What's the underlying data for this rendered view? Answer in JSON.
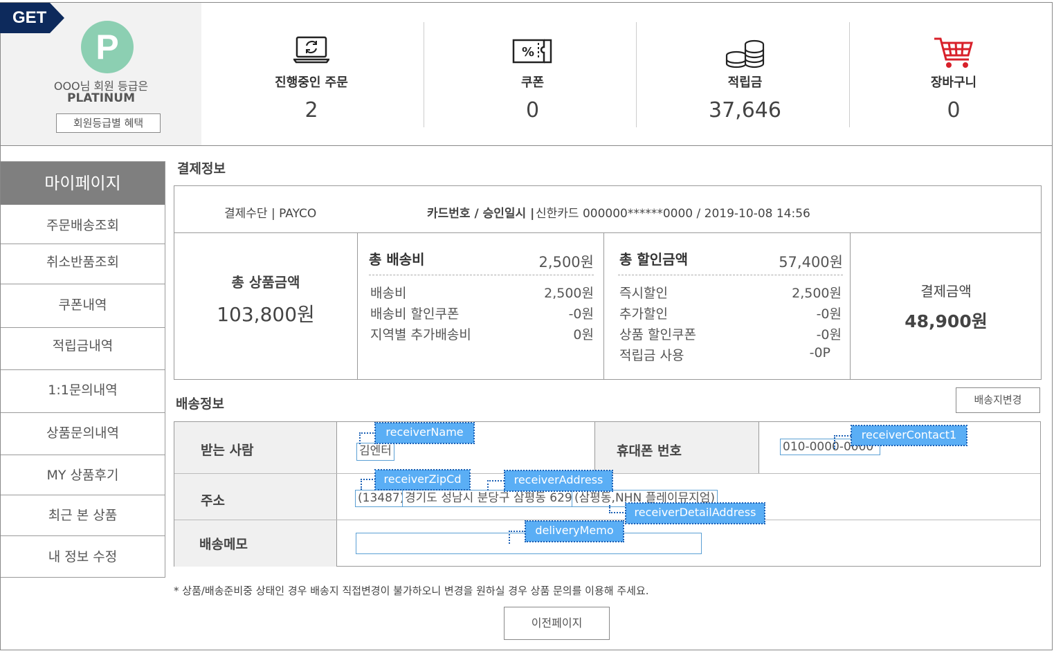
{
  "profile": {
    "badge": "GET",
    "logo_letter": "P",
    "grade_line": "OOO님 회원 등급은",
    "grade_name": "PLATINUM",
    "benefit_button": "회원등급별 혜택"
  },
  "stats": [
    {
      "label": "진행중인 주문",
      "value": "2",
      "icon": "laptop-refresh-icon"
    },
    {
      "label": "쿠폰",
      "value": "0",
      "icon": "coupon-icon"
    },
    {
      "label": "적립금",
      "value": "37,646",
      "icon": "coins-icon"
    },
    {
      "label": "장바구니",
      "value": "0",
      "icon": "cart-icon"
    }
  ],
  "sidebar": {
    "title": "마이페이지",
    "items": [
      "주문배송조회",
      "취소반품조회",
      "쿠폰내역",
      "적립금내역",
      "1:1문의내역",
      "상품문의내역",
      "MY 상품후기",
      "최근 본 상품",
      "내 정보 수정"
    ]
  },
  "payment": {
    "section_title": "결제정보",
    "method": "결제수단 | PAYCO",
    "card_label": "카드번호 / 승인일시 |",
    "card_value": "신한카드 000000******0000 / 2019-10-08 14:56",
    "product_total_label": "총 상품금액",
    "product_total_value": "103,800원",
    "shipping": {
      "title": "총 배송비",
      "total": "2,500원",
      "rows": [
        {
          "label": "배송비",
          "value": "2,500원"
        },
        {
          "label": "배송비 할인쿠폰",
          "value": "-0원"
        },
        {
          "label": "지역별 추가배송비",
          "value": "0원"
        }
      ]
    },
    "discount": {
      "title": "총 할인금액",
      "total": "57,400원",
      "rows": [
        {
          "label": "즉시할인",
          "value": "2,500원"
        },
        {
          "label": "추가할인",
          "value": "-0원"
        },
        {
          "label": "상품 할인쿠폰",
          "value": "-0원"
        },
        {
          "label": "적립금 사용",
          "value": "-0P"
        }
      ]
    },
    "final_label": "결제금액",
    "final_value": "48,900원"
  },
  "delivery": {
    "section_title": "배송정보",
    "change_button": "배송지변경",
    "receiver_label": "받는 사람",
    "receiver_value": "김엔터",
    "phone_label": "휴대폰 번호",
    "phone_value": "010-0000-0000",
    "address_label": "주소",
    "zip_value": "(13487)",
    "address_value": "경기도 성남시 분당구 삼평동 629",
    "detail_value": "(삼평동,NHN 플레이뮤지엄)",
    "memo_label": "배송메모",
    "memo_value": "",
    "tags": {
      "name": "receiverName",
      "contact": "receiverContact1",
      "zip": "receiverZipCd",
      "address": "receiverAddress",
      "detail": "receiverDetailAddress",
      "memo": "deliveryMemo"
    }
  },
  "notice": "* 상품/배송준비중 상태인 경우 배송지 직접변경이 불가하오니 변경을 원하실 경우 상품 문의를 이용해 주세요.",
  "prev_button": "이전페이지"
}
